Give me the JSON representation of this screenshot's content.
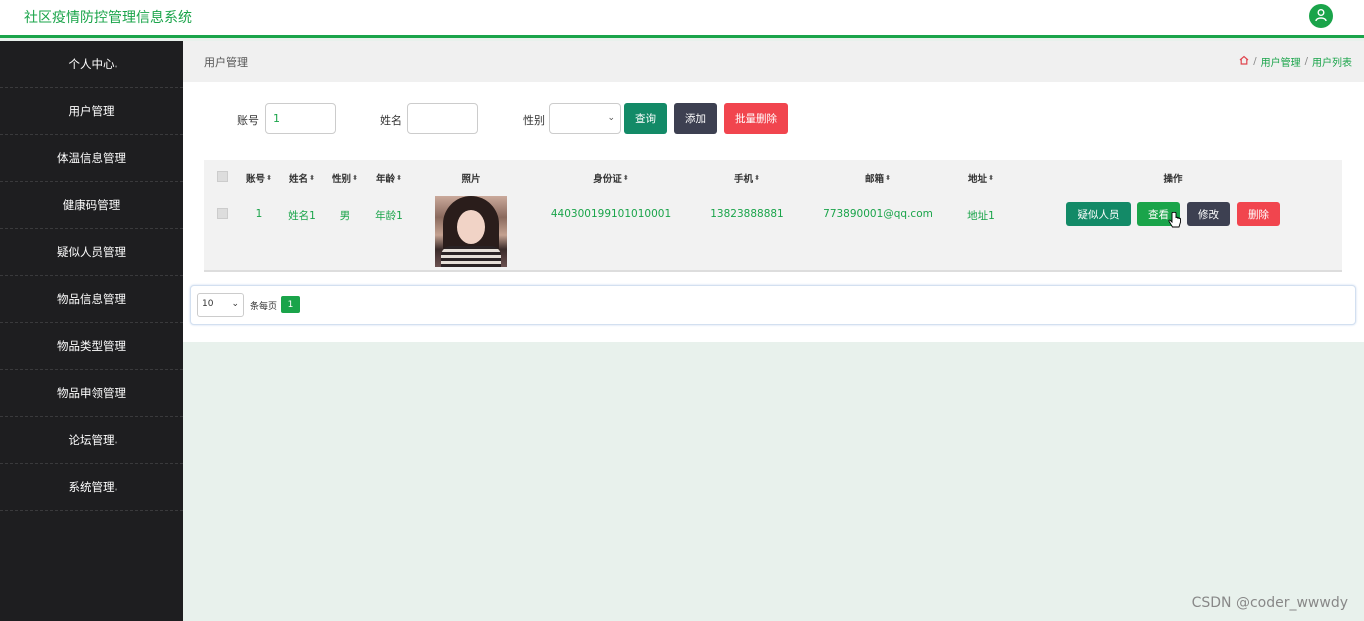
{
  "header": {
    "title": "社区疫情防控管理信息系统",
    "avatar_icon": "user-icon"
  },
  "sidebar": {
    "items": [
      {
        "label": "个人中心"
      },
      {
        "label": "用户管理"
      },
      {
        "label": "体温信息管理"
      },
      {
        "label": "健康码管理"
      },
      {
        "label": "疑似人员管理"
      },
      {
        "label": "物品信息管理"
      },
      {
        "label": "物品类型管理"
      },
      {
        "label": "物品申领管理"
      },
      {
        "label": "论坛管理"
      },
      {
        "label": "系统管理"
      }
    ]
  },
  "breadcrumb": {
    "page_title": "用户管理",
    "home_icon": "home-icon",
    "path": [
      "用户管理",
      "用户列表"
    ],
    "separator": "/"
  },
  "search": {
    "account_label": "账号",
    "account_value": "1",
    "name_label": "姓名",
    "name_value": "",
    "gender_label": "性别",
    "gender_value": "",
    "query_button": "查询",
    "add_button": "添加",
    "batch_delete_button": "批量删除"
  },
  "table": {
    "columns": [
      "账号",
      "姓名",
      "性别",
      "年龄",
      "照片",
      "身份证",
      "手机",
      "邮箱",
      "地址",
      "操作"
    ],
    "rows": [
      {
        "account": "1",
        "name": "姓名1",
        "gender": "男",
        "age": "年龄1",
        "id_card": "440300199101010001",
        "phone": "13823888881",
        "email": "773890001@qq.com",
        "address": "地址1",
        "actions": [
          "疑似人员",
          "查看",
          "修改",
          "删除"
        ]
      }
    ]
  },
  "pagination": {
    "page_size": "10",
    "per_page_text": "条每页",
    "current_page": "1"
  },
  "watermark": "CSDN @coder_wwwdy",
  "colors": {
    "brand": "#1aa44a",
    "teal": "#138a67",
    "dark": "#3d4051",
    "red": "#f1454e"
  }
}
